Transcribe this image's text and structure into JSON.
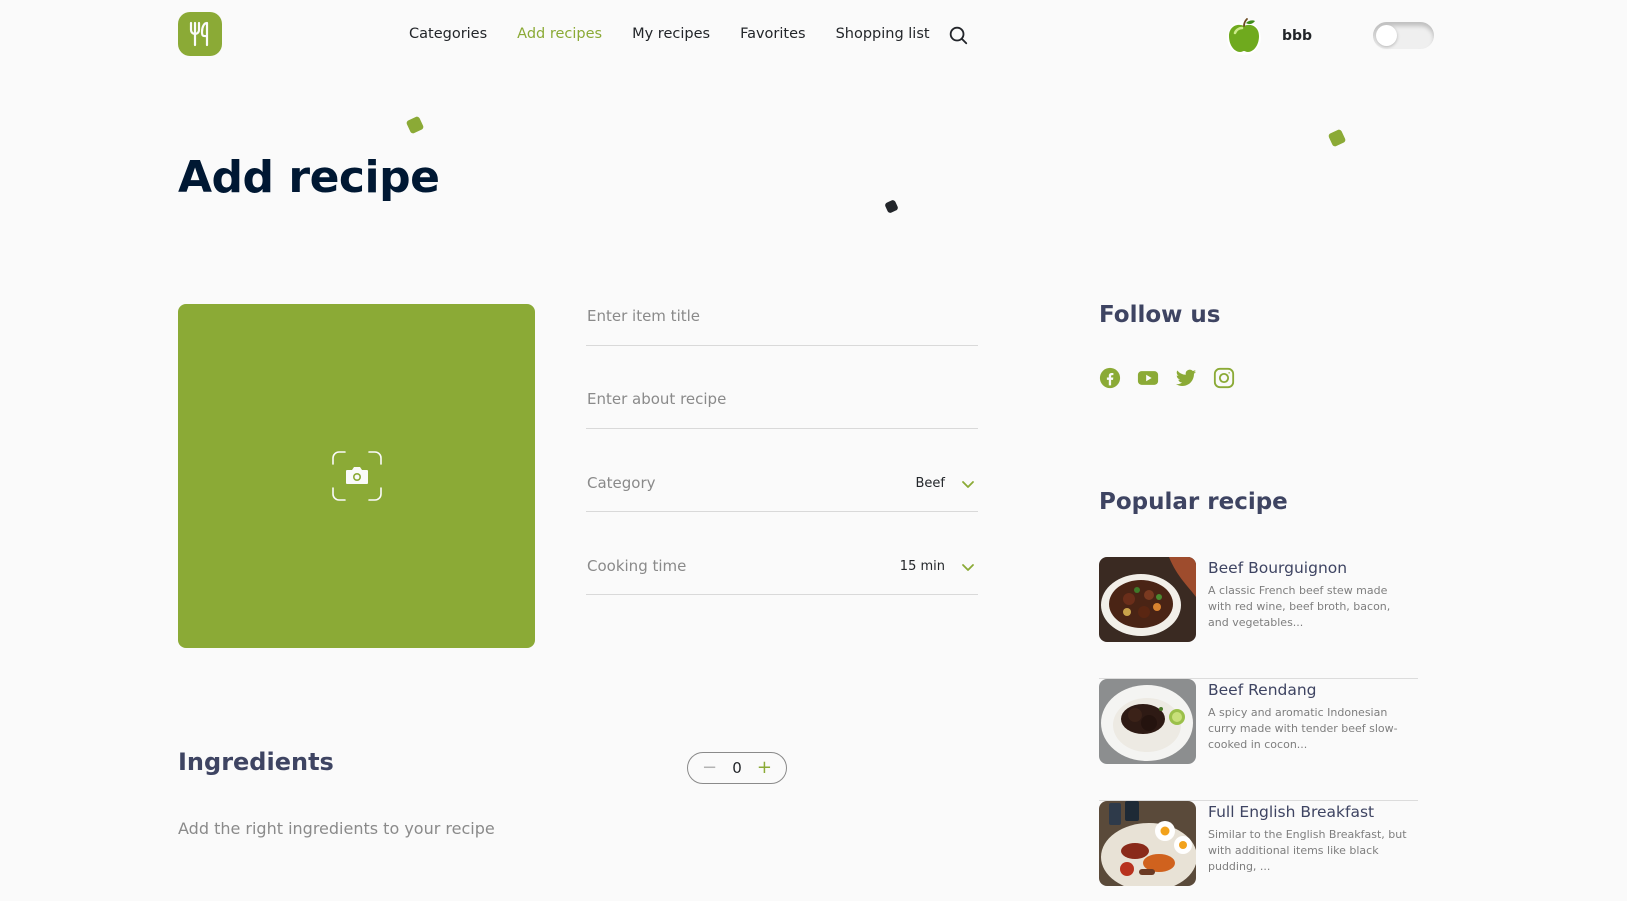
{
  "header": {
    "nav": [
      {
        "label": "Categories",
        "active": false
      },
      {
        "label": "Add recipes",
        "active": true
      },
      {
        "label": "My recipes",
        "active": false
      },
      {
        "label": "Favorites",
        "active": false
      },
      {
        "label": "Shopping list",
        "active": false
      }
    ],
    "user_name": "bbb",
    "theme_toggle_on": false,
    "logo_icon": "fork-knife-icon",
    "search_icon": "search-icon",
    "avatar_icon": "green-apple-avatar"
  },
  "page_title": "Add recipe",
  "form": {
    "upload_icon": "camera-icon",
    "title_placeholder": "Enter item title",
    "about_placeholder": "Enter about recipe",
    "category_label": "Category",
    "category_value": "Beef",
    "cooking_time_label": "Cooking time",
    "cooking_time_value": "15 min"
  },
  "ingredients": {
    "title": "Ingredients",
    "count": "0",
    "hint": "Add the right ingredients to your recipe"
  },
  "sidebar": {
    "follow_title": "Follow us",
    "socials": [
      "facebook-icon",
      "youtube-icon",
      "twitter-icon",
      "instagram-icon"
    ],
    "popular_title": "Popular recipe",
    "popular": [
      {
        "name": "Beef Bourguignon",
        "desc": "A classic French beef stew made with red wine, beef broth, bacon, and vegetables..."
      },
      {
        "name": "Beef Rendang",
        "desc": "A spicy and aromatic Indonesian curry made with tender beef slow-cooked in cocon..."
      },
      {
        "name": "Full English Breakfast",
        "desc": "Similar to the English Breakfast, but with additional items like black pudding, ..."
      }
    ]
  },
  "colors": {
    "accent": "#8BAA36",
    "title": "#001833",
    "heading": "#3E4462",
    "text": "#23262A",
    "muted": "#8A8A8A",
    "background": "#FAFAFA"
  }
}
